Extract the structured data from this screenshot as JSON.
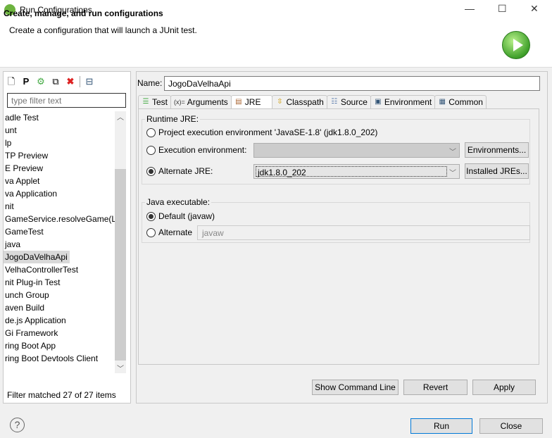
{
  "window": {
    "title": "Run Configurations",
    "minimize": "—",
    "maximize": "☐",
    "close": "✕"
  },
  "header": {
    "title": "Create, manage, and run configurations",
    "subtitle": "Create a configuration that will launch a JUnit test."
  },
  "left": {
    "filter_placeholder": "type filter text",
    "items": [
      "adle Test",
      "unt",
      "lp",
      "TP Preview",
      "E Preview",
      "va Applet",
      "va Application",
      "nit",
      "GameService.resolveGame(L",
      "GameTest",
      "java",
      "JogoDaVelhaApi",
      "VelhaControllerTest",
      "nit Plug-in Test",
      "unch Group",
      "aven Build",
      "de.js Application",
      "Gi Framework",
      "ring Boot App",
      "ring Boot Devtools Client"
    ],
    "selected_index": 11,
    "filter_status": "Filter matched 27 of 27 items"
  },
  "right": {
    "name_label": "Name:",
    "name_value": "JogoDaVelhaApi",
    "tabs": [
      "Test",
      "Arguments",
      "JRE",
      "Classpath",
      "Source",
      "Environment",
      "Common"
    ],
    "active_tab": "JRE",
    "runtime_group": "Runtime JRE:",
    "opt_project": "Project execution environment 'JavaSE-1.8' (jdk1.8.0_202)",
    "opt_exec": "Execution environment:",
    "opt_alt": "Alternate JRE:",
    "selected_runtime": "Alternate JRE",
    "alt_jre_value": "jdk1.8.0_202",
    "environments_btn": "Environments...",
    "installed_btn": "Installed JREs...",
    "exe_group": "Java executable:",
    "exe_default": "Default (javaw)",
    "exe_alt": "Alternate",
    "exe_alt_value": "javaw",
    "selected_exe": "Default (javaw)",
    "show_cmd": "Show Command Line",
    "revert": "Revert",
    "apply": "Apply"
  },
  "footer": {
    "help": "?",
    "run": "Run",
    "close": "Close"
  }
}
